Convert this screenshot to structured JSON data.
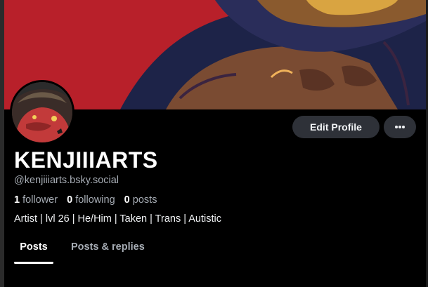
{
  "profile": {
    "display_name": "KENJIIIARTS",
    "handle": "@kenjiiiarts.bsky.social",
    "bio": "Artist | lvl 26 | He/Him | Taken | Trans | Autistic",
    "stats": {
      "followers_count": "1",
      "followers_label": "follower",
      "following_count": "0",
      "following_label": "following",
      "posts_count": "0",
      "posts_label": "posts"
    }
  },
  "actions": {
    "edit_profile_label": "Edit Profile",
    "more_icon": "ellipsis-icon"
  },
  "tabs": [
    {
      "label": "Posts",
      "active": true
    },
    {
      "label": "Posts & replies",
      "active": false
    }
  ],
  "colors": {
    "background": "#000000",
    "banner_red": "#b8202a",
    "button_bg": "#2e3138",
    "muted_text": "#a6acb4"
  }
}
